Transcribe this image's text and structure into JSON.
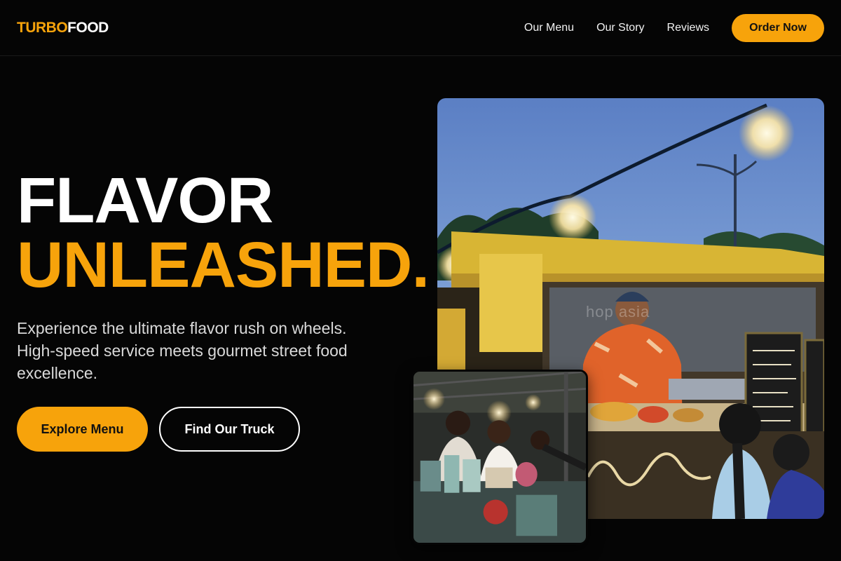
{
  "brand": {
    "part1": "TURBO",
    "part2": "FOOD",
    "accent": "#f7a30b"
  },
  "nav": {
    "links": [
      "Our Menu",
      "Our Story",
      "Reviews"
    ],
    "cta": "Order Now"
  },
  "hero": {
    "title_line1": "FLAVOR",
    "title_line2": "UNLEASHED.",
    "subtitle": "Experience the ultimate flavor rush on wheels. High-speed service meets gourmet street food excellence.",
    "primary_button": "Explore Menu",
    "secondary_button": "Find Our Truck"
  },
  "images": {
    "main": {
      "icon": "food-truck-photo",
      "watermark": "hop asia"
    },
    "secondary": {
      "icon": "food-stall-photo"
    }
  },
  "colors": {
    "background": "#050505",
    "accent": "#f7a30b",
    "text": "#ffffff"
  }
}
